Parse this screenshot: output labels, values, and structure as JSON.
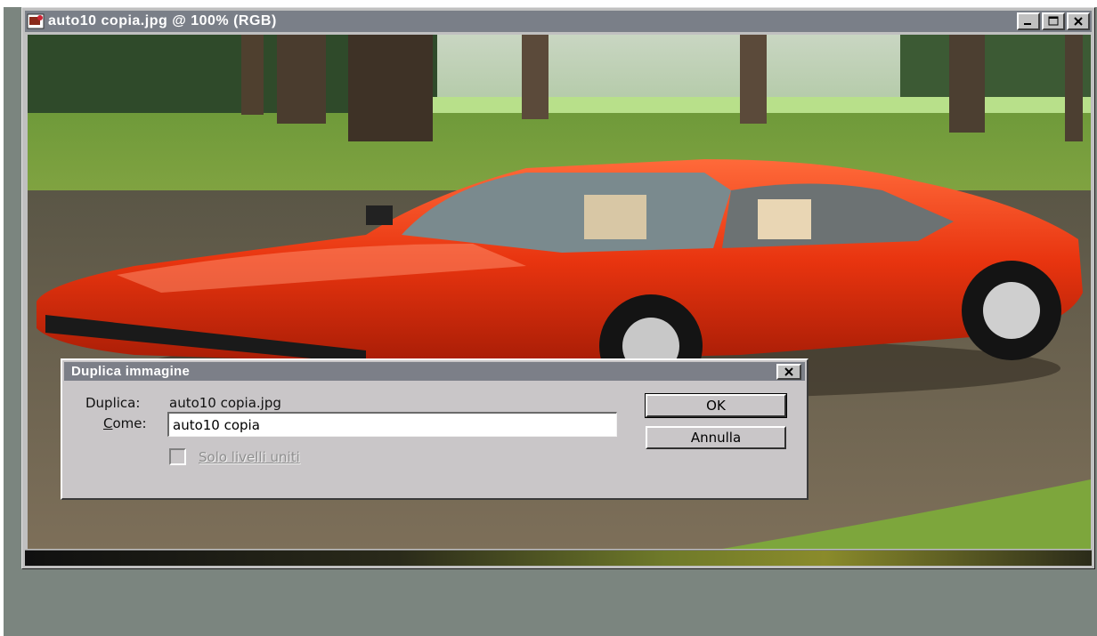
{
  "window": {
    "title": "auto10 copia.jpg @ 100% (RGB)",
    "icon": "photoshop-document-icon",
    "controls": [
      "minimize-icon",
      "maximize-icon",
      "close-icon"
    ]
  },
  "dialog": {
    "title": "Duplica immagine",
    "duplicate_label": "Duplica:",
    "duplicate_value": "auto10 copia.jpg",
    "as_label": "Come:",
    "as_value": "auto10 copia",
    "merged_layers_label": "Solo livelli uniti",
    "merged_layers_checked": false,
    "merged_layers_enabled": false,
    "ok_label": "OK",
    "cancel_label": "Annulla"
  },
  "colors": {
    "titlebar": "#7a7f88",
    "desktop": "#7b857f",
    "car_red": "#e03410"
  }
}
